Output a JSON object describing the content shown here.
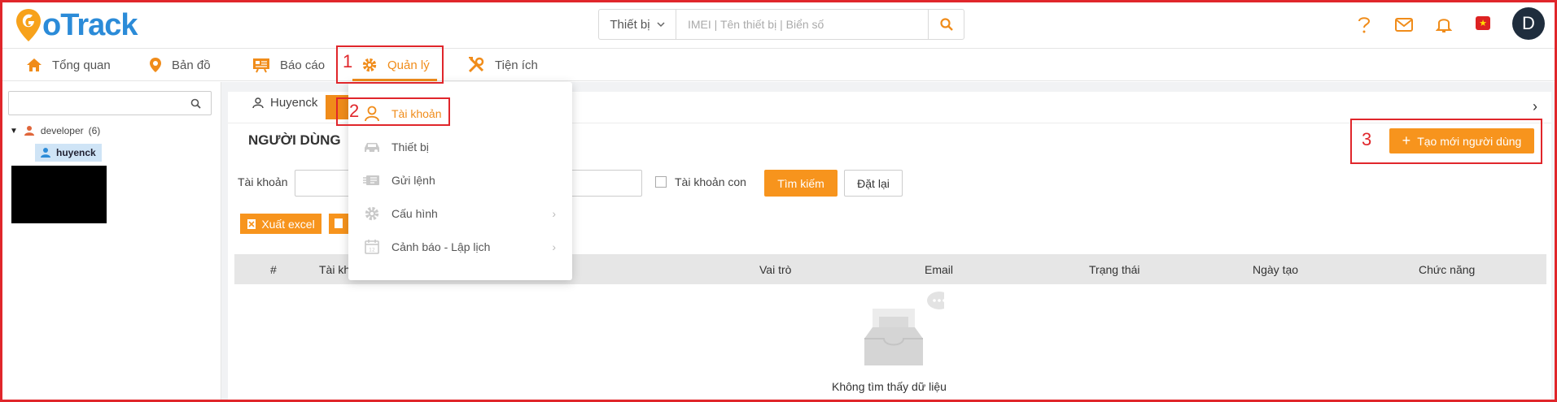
{
  "header": {
    "logo_text": "GoTrack",
    "search": {
      "type_label": "Thiết bị",
      "placeholder": "IMEI | Tên thiết bị | Biển số"
    },
    "icons": [
      "help-icon",
      "mail-icon",
      "bell-icon",
      "flag-icon"
    ],
    "avatar_initial": "D"
  },
  "nav": {
    "items": [
      {
        "label": "Tổng quan",
        "icon": "home-icon"
      },
      {
        "label": "Bản đồ",
        "icon": "map-pin-icon"
      },
      {
        "label": "Báo cáo",
        "icon": "report-icon"
      },
      {
        "label": "Quản lý",
        "icon": "gear-icon",
        "active": true
      },
      {
        "label": "Tiện ích",
        "icon": "tools-icon"
      }
    ]
  },
  "annotations": {
    "m1": "1",
    "m2": "2",
    "m3": "3"
  },
  "dropdown": {
    "items": [
      {
        "label": "Tài khoản",
        "icon": "user-icon",
        "active": true
      },
      {
        "label": "Thiết bị",
        "icon": "car-icon"
      },
      {
        "label": "Gửi lệnh",
        "icon": "send-command-icon"
      },
      {
        "label": "Cấu hình",
        "icon": "settings-icon",
        "has_submenu": true
      },
      {
        "label": "Cảnh báo - Lập lịch",
        "icon": "calendar-icon",
        "has_submenu": true
      }
    ]
  },
  "tree": {
    "root_label": "developer",
    "root_count": "(6)",
    "child_label": "huyenck"
  },
  "main": {
    "tab_label": "Huyenck",
    "page_title": "NGƯỜI DÙNG",
    "create_button": "Tạo mới người dùng",
    "filter_label": "Tài khoản",
    "sub_account_label": "Tài khoản con",
    "search_button": "Tìm kiếm",
    "reset_button": "Đặt lại",
    "excel_button": "Xuất excel",
    "table_headers": [
      "#",
      "Tài kh",
      "Vai trò",
      "Email",
      "Trạng thái",
      "Ngày tạo",
      "Chức năng"
    ],
    "empty_text": "Không tìm thấy dữ liệu"
  },
  "colors": {
    "accent": "#f7941d",
    "brand_blue": "#2b8bd8",
    "annotation_red": "#e0262b"
  }
}
